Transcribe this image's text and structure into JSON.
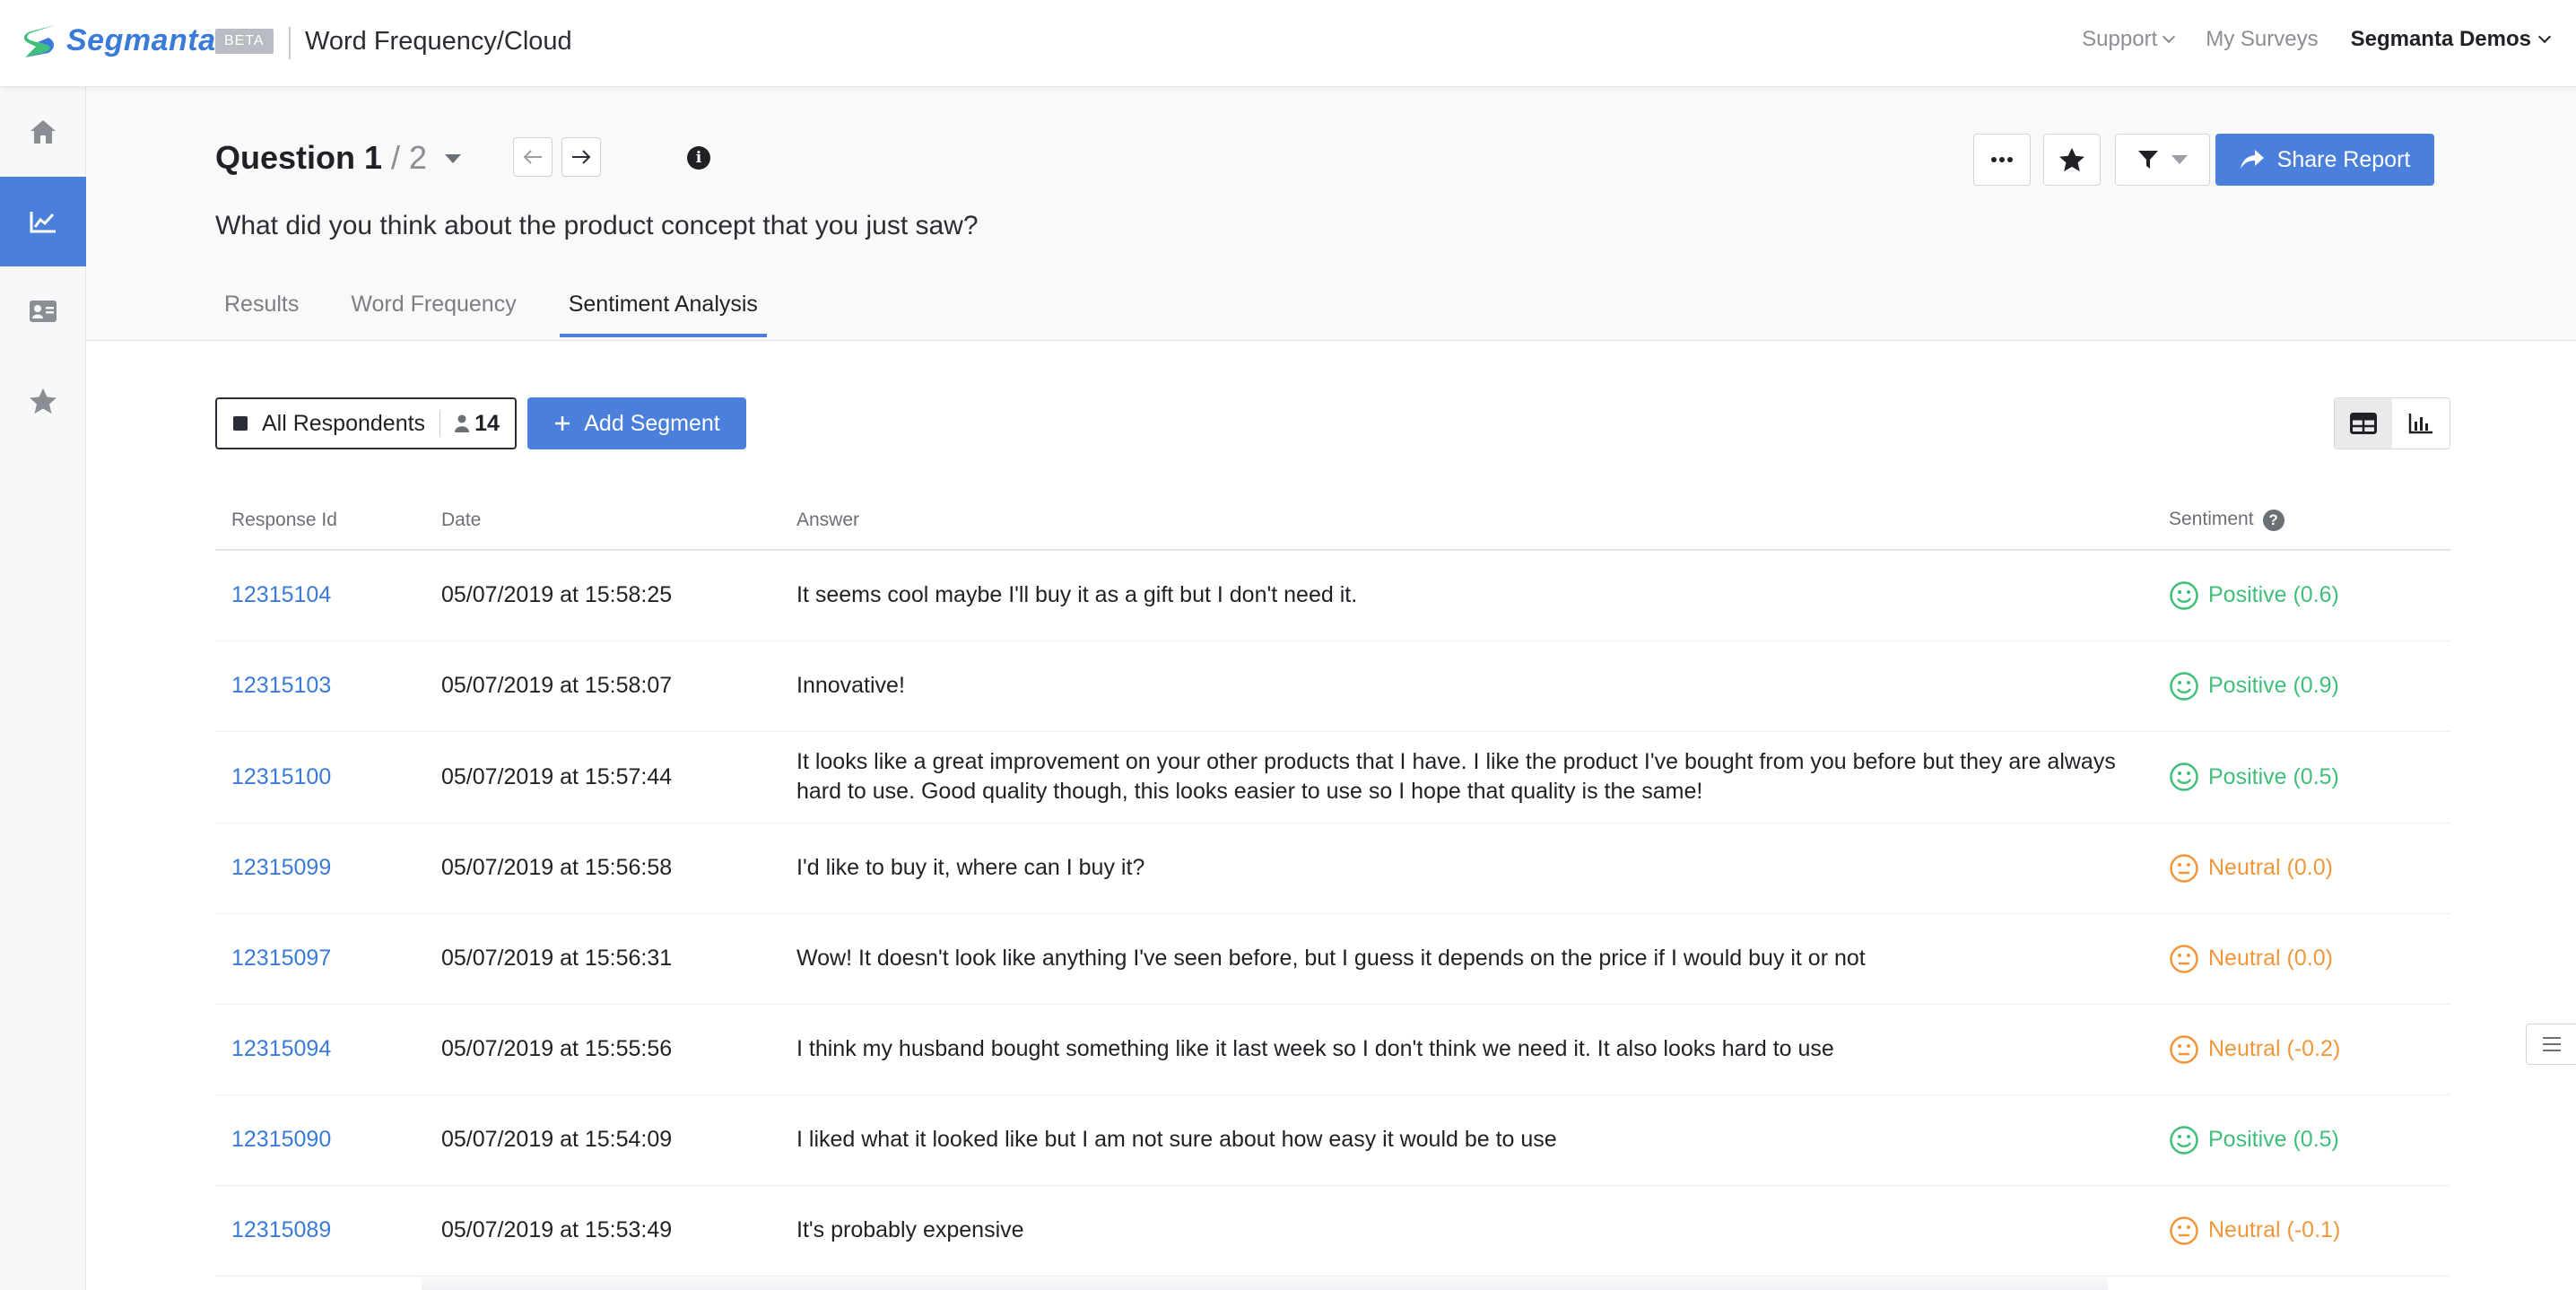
{
  "brand": {
    "logo_text": "Segmanta",
    "beta_label": "BETA",
    "app_title": "Word Frequency/Cloud",
    "accent": "#4a80db"
  },
  "topnav": {
    "support": "Support",
    "my_surveys": "My Surveys",
    "user": "Segmanta Demos"
  },
  "sidebar": {
    "items": [
      {
        "icon": "home-icon",
        "active": false
      },
      {
        "icon": "chart-icon",
        "active": true
      },
      {
        "icon": "contact-card-icon",
        "active": false
      },
      {
        "icon": "star-icon",
        "active": false
      }
    ]
  },
  "question": {
    "label": "Question 1",
    "total": "/ 2",
    "text": "What did you think about the product concept that you just saw?"
  },
  "tabs": [
    "Results",
    "Word Frequency",
    "Sentiment Analysis"
  ],
  "active_tab": "Sentiment Analysis",
  "actions": {
    "share_label": "Share Report"
  },
  "segment": {
    "name": "All Respondents",
    "count": "14",
    "add_label": "Add Segment"
  },
  "table": {
    "headers": {
      "id": "Response Id",
      "date": "Date",
      "answer": "Answer",
      "sentiment": "Sentiment"
    },
    "rows": [
      {
        "id": "12315104",
        "date": "05/07/2019 at 15:58:25",
        "answer": "It seems cool maybe I'll buy it as a gift but I don't need it.",
        "sentiment": "Positive (0.6)",
        "kind": "pos"
      },
      {
        "id": "12315103",
        "date": "05/07/2019 at 15:58:07",
        "answer": "Innovative!",
        "sentiment": "Positive (0.9)",
        "kind": "pos"
      },
      {
        "id": "12315100",
        "date": "05/07/2019 at 15:57:44",
        "answer": "It looks like a great improvement on your other products that I have. I like the product I've bought from you before but they are always hard to use. Good quality though, this looks easier to use so I hope that quality is the same!",
        "sentiment": "Positive (0.5)",
        "kind": "pos"
      },
      {
        "id": "12315099",
        "date": "05/07/2019 at 15:56:58",
        "answer": "I'd like to buy it, where can I buy it?",
        "sentiment": "Neutral (0.0)",
        "kind": "neu"
      },
      {
        "id": "12315097",
        "date": "05/07/2019 at 15:56:31",
        "answer": "Wow! It doesn't look like anything I've seen before, but I guess it depends on the price if I would buy it or not",
        "sentiment": "Neutral (0.0)",
        "kind": "neu"
      },
      {
        "id": "12315094",
        "date": "05/07/2019 at 15:55:56",
        "answer": "I think my husband bought something like it last week so I don't think we need it. It also looks hard to use",
        "sentiment": "Neutral (-0.2)",
        "kind": "neu"
      },
      {
        "id": "12315090",
        "date": "05/07/2019 at 15:54:09",
        "answer": "I liked what it looked like but I am not sure about how easy it would be to use",
        "sentiment": "Positive (0.5)",
        "kind": "pos"
      },
      {
        "id": "12315089",
        "date": "05/07/2019 at 15:53:49",
        "answer": "It's probably expensive",
        "sentiment": "Neutral (-0.1)",
        "kind": "neu"
      }
    ]
  }
}
